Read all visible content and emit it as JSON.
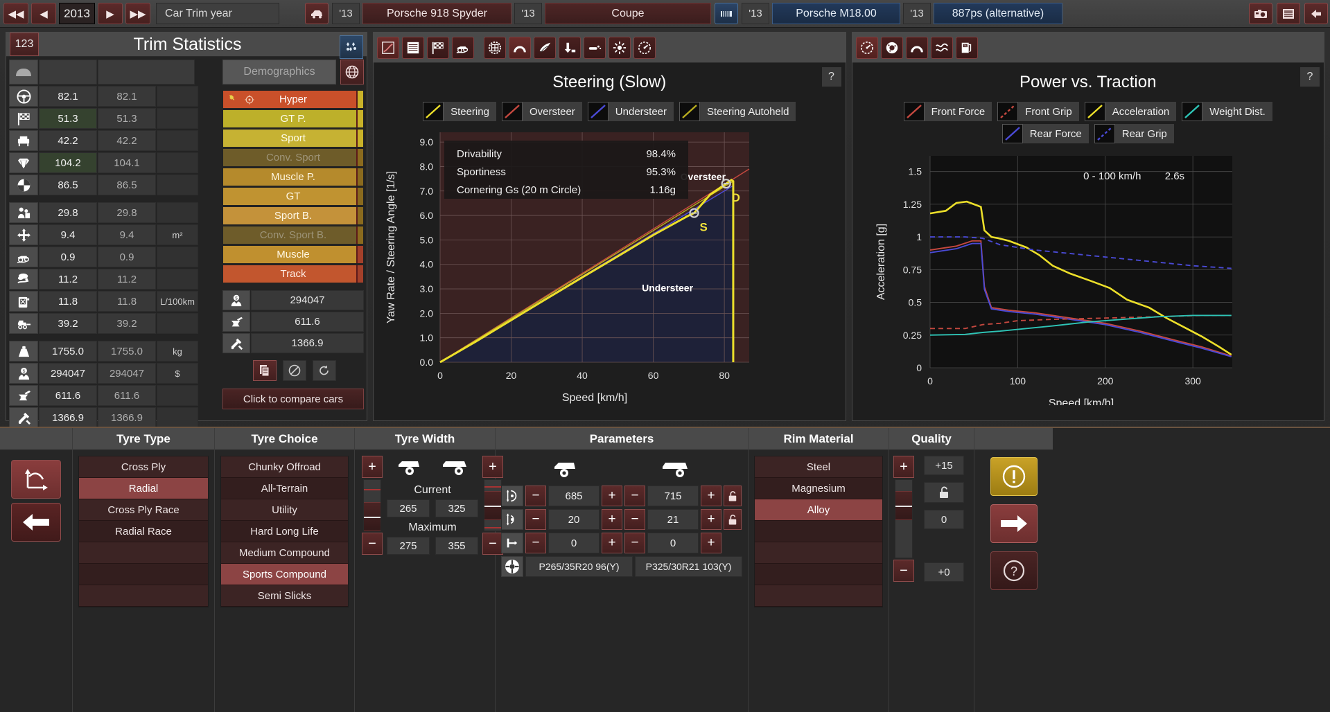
{
  "topbar": {
    "nav": {
      "first": "◀◀",
      "prev": "◀",
      "next": "▶",
      "last": "▶▶"
    },
    "year": "2013",
    "year_label": "Car Trim year",
    "model_year": "'13",
    "model_name": "Porsche 918 Spyder",
    "body_year": "'13",
    "body_name": "Coupe",
    "engine_year": "'13",
    "engine_name": "Porsche M18.00",
    "variant_year": "'13",
    "variant_name": "887ps (alternative)",
    "icons": {
      "car": "car-icon",
      "engine": "engine-icon",
      "camera": "camera-icon",
      "report": "report-icon",
      "back": "back-arrow-icon"
    }
  },
  "trim_panel": {
    "badge": "123",
    "title": "Trim Statistics",
    "corner_icon": "compare-icon",
    "demographics_label": "Demographics",
    "globe_icon": "globe-icon",
    "compare_button": "Click to compare cars",
    "header_icon": "car-front-icon",
    "stats": [
      {
        "icon": "steering-wheel-icon",
        "v1": "82.1",
        "v2": "82.1",
        "unit": "",
        "highlight": false
      },
      {
        "icon": "checkered-flag-icon",
        "v1": "51.3",
        "v2": "51.3",
        "unit": "",
        "highlight": true
      },
      {
        "icon": "armchair-icon",
        "v1": "42.2",
        "v2": "42.2",
        "unit": "",
        "highlight": false
      },
      {
        "icon": "diamond-icon",
        "v1": "104.2",
        "v2": "104.1",
        "unit": "",
        "highlight": true
      },
      {
        "icon": "pie-chart-icon",
        "v1": "86.5",
        "v2": "86.5",
        "unit": "",
        "highlight": false
      },
      {
        "icon": "passengers-icon",
        "v1": "29.8",
        "v2": "29.8",
        "unit": "",
        "highlight": false
      },
      {
        "icon": "cargo-volume-icon",
        "v1": "9.4",
        "v2": "9.4",
        "unit": "m²",
        "highlight": false
      },
      {
        "icon": "offroad-icon",
        "v1": "0.9",
        "v2": "0.9",
        "unit": "",
        "highlight": false
      },
      {
        "icon": "emissions-icon",
        "v1": "11.2",
        "v2": "11.2",
        "unit": "",
        "highlight": false
      },
      {
        "icon": "fuel-can-icon",
        "v1": "11.8",
        "v2": "11.8",
        "unit": "L/100km",
        "highlight": false
      },
      {
        "icon": "tow-icon",
        "v1": "39.2",
        "v2": "39.2",
        "unit": "",
        "highlight": false
      },
      {
        "icon": "weight-icon",
        "v1": "1755.0",
        "v2": "1755.0",
        "unit": "kg",
        "highlight": false
      },
      {
        "icon": "price-icon",
        "v1": "294047",
        "v2": "294047",
        "unit": "$",
        "highlight": false
      },
      {
        "icon": "anvil-icon",
        "v1": "611.6",
        "v2": "611.6",
        "unit": "",
        "highlight": false
      },
      {
        "icon": "tools-icon",
        "v1": "1366.9",
        "v2": "1366.9",
        "unit": "",
        "highlight": false
      }
    ],
    "demographics": [
      {
        "label": "Hyper",
        "color": "#c9502a",
        "text": "#ffffff",
        "dim": false,
        "pins": true
      },
      {
        "label": "GT P.",
        "color": "#bdb02a",
        "text": "#fdfde8",
        "dim": false,
        "pins": false
      },
      {
        "label": "Sport",
        "color": "#c6b233",
        "text": "#fffde8",
        "dim": false,
        "pins": false
      },
      {
        "label": "Conv. Sport",
        "color": "#6e5c29",
        "text": "#9e9478",
        "dim": true,
        "pins": false
      },
      {
        "label": "Muscle P.",
        "color": "#b58a2c",
        "text": "#fff6e0",
        "dim": false,
        "pins": false
      },
      {
        "label": "GT",
        "color": "#c09331",
        "text": "#fff8e4",
        "dim": false,
        "pins": false
      },
      {
        "label": "Sport B.",
        "color": "#c4923a",
        "text": "#fff8e6",
        "dim": false,
        "pins": false
      },
      {
        "label": "Conv. Sport B.",
        "color": "#6e5c2a",
        "text": "#9d9478",
        "dim": true,
        "pins": false
      },
      {
        "label": "Muscle",
        "color": "#c0902f",
        "text": "#fff6e0",
        "dim": false,
        "pins": false
      },
      {
        "label": "Track",
        "color": "#c2562e",
        "text": "#ffeee6",
        "dim": false,
        "pins": false
      }
    ],
    "demo_stats": [
      {
        "icon": "price-icon",
        "value": "294047"
      },
      {
        "icon": "anvil-icon",
        "value": "611.6"
      },
      {
        "icon": "tools-icon",
        "value": "1366.9"
      }
    ],
    "tools": [
      {
        "icon": "copy-icon",
        "active": true
      },
      {
        "icon": "ban-icon",
        "active": false
      },
      {
        "icon": "reset-icon",
        "active": false
      }
    ]
  },
  "steering_panel": {
    "title": "Steering (Slow)",
    "help": "?",
    "toolbar": [
      {
        "icon": "graph-icon",
        "active": true
      },
      {
        "icon": "table-icon",
        "active": false
      },
      {
        "icon": "checkered-flag-icon",
        "active": false
      },
      {
        "icon": "offroad-icon",
        "active": false
      },
      {
        "icon": "gearbox-icon",
        "active": false
      },
      {
        "icon": "suspension-icon",
        "active": true
      },
      {
        "icon": "aero-icon",
        "active": false
      },
      {
        "icon": "brake-icon",
        "active": false
      },
      {
        "icon": "exhaust-icon",
        "active": false
      },
      {
        "icon": "cooling-icon",
        "active": false
      },
      {
        "icon": "gauge-icon",
        "active": false
      }
    ],
    "legend": [
      {
        "label": "Steering",
        "color": "#ecdf2a"
      },
      {
        "label": "Oversteer",
        "color": "#c4483f"
      },
      {
        "label": "Understeer",
        "color": "#4a4ad6"
      },
      {
        "label": "Steering Autoheld",
        "color": "#b8ad1f"
      }
    ],
    "info": [
      {
        "key": "Drivability",
        "value": "98.4%"
      },
      {
        "key": "Sportiness",
        "value": "95.3%"
      },
      {
        "key": "Cornering Gs (20 m Circle)",
        "value": "1.16g"
      }
    ],
    "zones": {
      "over": "Oversteer",
      "under": "Understeer"
    },
    "markers": [
      {
        "label": "S",
        "x": 71.5,
        "y": 6.1
      },
      {
        "label": "D",
        "x": 80.5,
        "y": 7.3
      }
    ],
    "chart_data": {
      "type": "line",
      "title": "Steering (Slow)",
      "xlabel": "Speed [km/h]",
      "ylabel": "Yaw Rate / Steering Angle [1/s]",
      "xlim": [
        0,
        87
      ],
      "ylim": [
        0,
        9.4
      ],
      "xticks": [
        0,
        20,
        40,
        60,
        80
      ],
      "yticks": [
        "0.0",
        "1.0",
        "2.0",
        "3.0",
        "4.0",
        "5.0",
        "6.0",
        "7.0",
        "8.0",
        "9.0"
      ],
      "grid": true,
      "series": [
        {
          "name": "Steering",
          "color": "#ecdf2a",
          "x": [
            0,
            10,
            20,
            30,
            40,
            50,
            60,
            70,
            71.5,
            76,
            80.5,
            82,
            82.5,
            82.5
          ],
          "y": [
            0,
            0.84,
            1.72,
            2.6,
            3.47,
            4.33,
            5.2,
            6.0,
            6.1,
            6.85,
            7.3,
            7.45,
            7.4,
            0
          ]
        },
        {
          "name": "Oversteer",
          "color": "#c4483f",
          "x": [
            0,
            87
          ],
          "y": [
            0,
            7.9
          ]
        },
        {
          "name": "Understeer",
          "color": "#4a4ad6",
          "x": [
            0,
            82.5
          ],
          "y": [
            0,
            7.22
          ]
        },
        {
          "name": "Steering Autoheld",
          "color": "#b8ad1f",
          "x": [
            0,
            82.5
          ],
          "y": [
            0,
            7.4
          ]
        }
      ]
    }
  },
  "power_panel": {
    "title": "Power vs. Traction",
    "help": "?",
    "toolbar": [
      {
        "icon": "gauge-icon",
        "active": true
      },
      {
        "icon": "brake-disc-icon",
        "active": false
      },
      {
        "icon": "suspension-icon",
        "active": false
      },
      {
        "icon": "wave-icon",
        "active": false
      },
      {
        "icon": "fuel-pump-icon",
        "active": false
      }
    ],
    "legend": [
      {
        "label": "Front Force",
        "color": "#c4483f",
        "dashed": false
      },
      {
        "label": "Front Grip",
        "color": "#c4483f",
        "dashed": true
      },
      {
        "label": "Acceleration",
        "color": "#ecdf2a",
        "dashed": false
      },
      {
        "label": "Weight Dist.",
        "color": "#2ec4b6",
        "dashed": false
      },
      {
        "label": "Rear Force",
        "color": "#4a4ad6",
        "dashed": false
      },
      {
        "label": "Rear Grip",
        "color": "#4a4ad6",
        "dashed": true
      }
    ],
    "annotation": {
      "key": "0 - 100 km/h",
      "value": "2.6s"
    },
    "chart_data": {
      "type": "line",
      "title": "Power vs. Traction",
      "xlabel": "Speed [km/h]",
      "ylabel": "Acceleration [g]",
      "xlim": [
        0,
        345
      ],
      "ylim": [
        0,
        1.62
      ],
      "xticks": [
        0,
        100,
        200,
        300
      ],
      "yticks": [
        "0",
        "0.25",
        "0.5",
        "0.75",
        "1",
        "1.25",
        "1.5"
      ],
      "grid": true,
      "series": [
        {
          "name": "Acceleration",
          "color": "#ecdf2a",
          "dashed": false,
          "x": [
            0,
            18,
            30,
            42,
            50,
            58,
            62,
            70,
            78,
            90,
            110,
            125,
            140,
            160,
            185,
            205,
            225,
            250,
            270,
            290,
            310,
            330,
            344
          ],
          "y": [
            1.18,
            1.2,
            1.26,
            1.27,
            1.25,
            1.23,
            1.05,
            1.0,
            0.99,
            0.97,
            0.92,
            0.86,
            0.78,
            0.72,
            0.66,
            0.61,
            0.52,
            0.46,
            0.38,
            0.31,
            0.24,
            0.16,
            0.1
          ]
        },
        {
          "name": "Front Force",
          "color": "#c4483f",
          "dashed": false,
          "x": [
            0,
            30,
            48,
            58,
            62,
            70,
            90,
            120,
            160,
            200,
            240,
            280,
            310,
            344
          ],
          "y": [
            0.9,
            0.93,
            0.97,
            0.97,
            0.62,
            0.46,
            0.44,
            0.42,
            0.38,
            0.34,
            0.28,
            0.21,
            0.16,
            0.09
          ]
        },
        {
          "name": "Rear Force",
          "color": "#4a4ad6",
          "dashed": false,
          "x": [
            0,
            30,
            48,
            58,
            62,
            70,
            90,
            120,
            160,
            200,
            240,
            280,
            310,
            344
          ],
          "y": [
            0.88,
            0.91,
            0.95,
            0.95,
            0.6,
            0.45,
            0.43,
            0.41,
            0.37,
            0.33,
            0.27,
            0.2,
            0.15,
            0.085
          ]
        },
        {
          "name": "Front Grip",
          "color": "#c4483f",
          "dashed": true,
          "x": [
            0,
            40,
            60,
            80,
            100,
            140,
            200,
            260,
            310,
            344
          ],
          "y": [
            0.3,
            0.3,
            0.33,
            0.34,
            0.36,
            0.37,
            0.38,
            0.39,
            0.4,
            0.4
          ]
        },
        {
          "name": "Rear Grip",
          "color": "#4a4ad6",
          "dashed": true,
          "x": [
            0,
            40,
            60,
            80,
            120,
            180,
            240,
            300,
            344
          ],
          "y": [
            1.0,
            1.0,
            0.99,
            0.94,
            0.9,
            0.86,
            0.82,
            0.78,
            0.76
          ]
        },
        {
          "name": "Weight Dist.",
          "color": "#2ec4b6",
          "dashed": false,
          "x": [
            0,
            40,
            60,
            80,
            110,
            140,
            180,
            220,
            260,
            300,
            344
          ],
          "y": [
            0.25,
            0.255,
            0.27,
            0.28,
            0.3,
            0.32,
            0.35,
            0.37,
            0.39,
            0.4,
            0.4
          ]
        }
      ]
    }
  },
  "bottom": {
    "nav": {
      "graph_icon": "curve-axes-icon",
      "back_icon": "back-arrow-icon"
    },
    "tyre_type": {
      "header": "Tyre Type",
      "options": [
        "Cross Ply",
        "Radial",
        "Cross Ply Race",
        "Radial Race",
        "",
        "",
        ""
      ],
      "selected": "Radial"
    },
    "tyre_choice": {
      "header": "Tyre Choice",
      "options": [
        "Chunky Offroad",
        "All-Terrain",
        "Utility",
        "Hard Long Life",
        "Medium Compound",
        "Sports Compound",
        "Semi Slicks"
      ],
      "selected": "Sports Compound"
    },
    "tyre_width": {
      "header": "Tyre Width",
      "front_icon": "front-tyre-icon",
      "rear_icon": "rear-tyre-icon",
      "current_label": "Current",
      "current_front": "265",
      "current_rear": "325",
      "maximum_label": "Maximum",
      "maximum_front": "275",
      "maximum_rear": "355",
      "plus": "+",
      "minus": "−"
    },
    "parameters": {
      "header": "Parameters",
      "front_icon": "front-axle-icon",
      "rear_icon": "rear-axle-icon",
      "rows": [
        {
          "icon": "rim-diameter-icon",
          "front": "685",
          "rear": "715",
          "lock": true,
          "lock_icon": "unlocked-icon"
        },
        {
          "icon": "rim-height-icon",
          "front": "20",
          "rear": "21",
          "lock": true,
          "lock_icon": "unlocked-icon"
        },
        {
          "icon": "offset-icon",
          "front": "0",
          "rear": "0",
          "lock": false,
          "lock_icon": ""
        }
      ],
      "tyre_icon": "wheel-icon",
      "tyre_front": "P265/35R20 96(Y)",
      "tyre_rear": "P325/30R21  103(Y)",
      "plus": "+",
      "minus": "−"
    },
    "rim_material": {
      "header": "Rim Material",
      "options": [
        "Steel",
        "Magnesium",
        "Alloy",
        "",
        "",
        "",
        ""
      ],
      "selected": "Alloy"
    },
    "quality": {
      "header": "Quality",
      "plus": "+",
      "minus": "−",
      "value_top": "+15",
      "value_mid": "0",
      "value_bot": "+0",
      "lock_icon": "unlocked-icon"
    },
    "right_nav": {
      "warn_icon": "warning-icon",
      "forward_icon": "forward-arrow-icon",
      "help_icon": "help-icon"
    }
  }
}
